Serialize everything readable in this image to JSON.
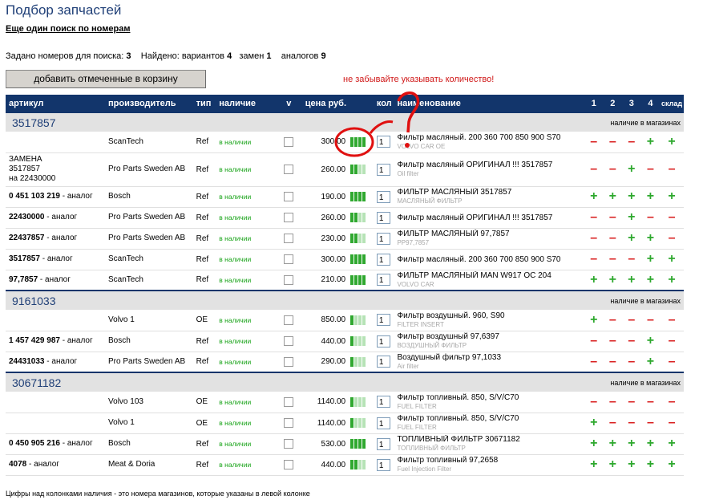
{
  "page": {
    "title": "Подбор запчастей",
    "search_link": "Еще один поиск по номерам",
    "stats": {
      "numbers_label": "Задано номеров для поиска:",
      "numbers_value": "3",
      "found_label": "Найдено: вариантов",
      "variants_value": "4",
      "replacements_label": "замен",
      "replacements_value": "1",
      "analogs_label": "аналогов",
      "analogs_value": "9"
    },
    "add_to_cart_label": "добавить отмеченные в корзину",
    "reminder": "не забывайте указывать количество!",
    "footer_note": "Цифры над колонками наличия - это номера магазинов, которые указаны в левой колонке"
  },
  "table": {
    "headers": {
      "article": "артикул",
      "manufacturer": "производитель",
      "type": "тип",
      "availability": "наличие",
      "select": "v",
      "price": "цена руб.",
      "qty": "кол",
      "name": "наименование",
      "store1": "1",
      "store2": "2",
      "store3": "3",
      "store4": "4",
      "warehouse": "склад"
    },
    "store_availability_label": "наличие в магазинах",
    "groups": [
      {
        "number": "3517857",
        "rows": [
          {
            "article": "",
            "manufacturer": "ScanTech",
            "type": "Ref",
            "availability": "в наличии",
            "price": "300.00",
            "stock_level": 4,
            "qty": "1",
            "name": "Фильтр масляный. 200 360 700 850 900 S70",
            "name_sub": "VOLVO CAR OE",
            "stores": [
              "minus",
              "minus",
              "minus",
              "plus",
              "plus"
            ]
          },
          {
            "article_lines": [
              "ЗАМЕНА",
              "3517857",
              "на 22430000"
            ],
            "manufacturer": "Pro Parts Sweden AB",
            "type": "Ref",
            "availability": "в наличии",
            "price": "260.00",
            "stock_level": 2,
            "qty": "1",
            "name": "Фильтр масляный ОРИГИНАЛ !!! 3517857",
            "name_sub": "Oil filter",
            "stores": [
              "minus",
              "minus",
              "plus",
              "minus",
              "minus"
            ]
          },
          {
            "article_bold": "0 451 103 219",
            "article_suffix": " - аналог",
            "manufacturer": "Bosch",
            "type": "Ref",
            "availability": "в наличии",
            "price": "190.00",
            "stock_level": 4,
            "qty": "1",
            "name": "ФИЛЬТР МАСЛЯНЫЙ 3517857",
            "name_sub": "МАСЛЯНЫЙ ФИЛЬТР",
            "stores": [
              "plus",
              "plus",
              "plus",
              "plus",
              "plus"
            ]
          },
          {
            "article_bold": "22430000",
            "article_suffix": " - аналог",
            "manufacturer": "Pro Parts Sweden AB",
            "type": "Ref",
            "availability": "в наличии",
            "price": "260.00",
            "stock_level": 2,
            "qty": "1",
            "name": "Фильтр масляный ОРИГИНАЛ !!! 3517857",
            "name_sub": "",
            "stores": [
              "minus",
              "minus",
              "plus",
              "minus",
              "minus"
            ]
          },
          {
            "article_bold": "22437857",
            "article_suffix": " - аналог",
            "manufacturer": "Pro Parts Sweden AB",
            "type": "Ref",
            "availability": "в наличии",
            "price": "230.00",
            "stock_level": 2,
            "qty": "1",
            "name": "ФИЛЬТР МАСЛЯНЫЙ 97,7857",
            "name_sub": "PP97,7857",
            "stores": [
              "minus",
              "minus",
              "plus",
              "plus",
              "minus"
            ]
          },
          {
            "article_bold": "3517857",
            "article_suffix": " - аналог",
            "manufacturer": "ScanTech",
            "type": "Ref",
            "availability": "в наличии",
            "price": "300.00",
            "stock_level": 4,
            "qty": "1",
            "name": "Фильтр масляный. 200 360 700 850 900 S70",
            "name_sub": "",
            "stores": [
              "minus",
              "minus",
              "minus",
              "plus",
              "plus"
            ]
          },
          {
            "article_bold": "97,7857",
            "article_suffix": " - аналог",
            "manufacturer": "ScanTech",
            "type": "Ref",
            "availability": "в наличии",
            "price": "210.00",
            "stock_level": 4,
            "qty": "1",
            "name": "ФИЛЬТР МАСЛЯНЫЙ MAN W917 OC 204",
            "name_sub": "VOLVO CAR",
            "stores": [
              "plus",
              "plus",
              "plus",
              "plus",
              "plus"
            ]
          }
        ]
      },
      {
        "number": "9161033",
        "rows": [
          {
            "article": "",
            "manufacturer": "Volvo 1",
            "type": "OE",
            "availability": "в наличии",
            "price": "850.00",
            "stock_level": 1,
            "qty": "1",
            "name": "Фильтр воздушный. 960, S90",
            "name_sub": "FILTER INSERT",
            "stores": [
              "plus",
              "minus",
              "minus",
              "minus",
              "minus"
            ]
          },
          {
            "article_bold": "1 457 429 987",
            "article_suffix": " - аналог",
            "manufacturer": "Bosch",
            "type": "Ref",
            "availability": "в наличии",
            "price": "440.00",
            "stock_level": 1,
            "qty": "1",
            "name": "Фильтр воздушный 97,6397",
            "name_sub": "ВОЗДУШНЫЙ ФИЛЬТР",
            "stores": [
              "minus",
              "minus",
              "minus",
              "plus",
              "minus"
            ]
          },
          {
            "article_bold": "24431033",
            "article_suffix": " - аналог",
            "manufacturer": "Pro Parts Sweden AB",
            "type": "Ref",
            "availability": "в наличии",
            "price": "290.00",
            "stock_level": 1,
            "qty": "1",
            "name": "Воздушный фильтр 97,1033",
            "name_sub": "Air filter",
            "stores": [
              "minus",
              "minus",
              "minus",
              "plus",
              "minus"
            ]
          }
        ]
      },
      {
        "number": "30671182",
        "rows": [
          {
            "article": "",
            "manufacturer": "Volvo 103",
            "type": "OE",
            "availability": "в наличии",
            "price": "1140.00",
            "stock_level": 1,
            "qty": "1",
            "name": "Фильтр топливный. 850, S/V/C70",
            "name_sub": "FUEL FILTER",
            "stores": [
              "minus",
              "minus",
              "minus",
              "minus",
              "minus"
            ]
          },
          {
            "article": "",
            "manufacturer": "Volvo 1",
            "type": "OE",
            "availability": "в наличии",
            "price": "1140.00",
            "stock_level": 1,
            "qty": "1",
            "name": "Фильтр топливный. 850, S/V/C70",
            "name_sub": "FUEL FILTER",
            "stores": [
              "plus",
              "minus",
              "minus",
              "minus",
              "minus"
            ]
          },
          {
            "article_bold": "0 450 905 216",
            "article_suffix": " - аналог",
            "manufacturer": "Bosch",
            "type": "Ref",
            "availability": "в наличии",
            "price": "530.00",
            "stock_level": 4,
            "qty": "1",
            "name": "ТОПЛИВНЫЙ ФИЛЬТР 30671182",
            "name_sub": "ТОПЛИВНЫЙ ФИЛЬТР",
            "stores": [
              "plus",
              "plus",
              "plus",
              "plus",
              "plus"
            ]
          },
          {
            "article_bold": "4078",
            "article_suffix": " - аналог",
            "manufacturer": "Meat & Doria",
            "type": "Ref",
            "availability": "в наличии",
            "price": "440.00",
            "stock_level": 2,
            "qty": "1",
            "name": "Фильтр топливный 97,2658",
            "name_sub": "Fuel Injection Filter",
            "stores": [
              "plus",
              "plus",
              "plus",
              "plus",
              "plus"
            ]
          }
        ]
      }
    ]
  },
  "colors": {
    "header_bg": "#12356b",
    "group_bg": "#e2e2e2",
    "plus": "#2da82d",
    "minus": "#d92020",
    "stock_on": "#2fa82f",
    "stock_off": "#b6e3b6",
    "reminder": "#d01818",
    "annotation": "#e01010"
  },
  "icons": {
    "plus": "plus-icon",
    "minus": "minus-icon",
    "stock": "stock-bars-icon"
  }
}
